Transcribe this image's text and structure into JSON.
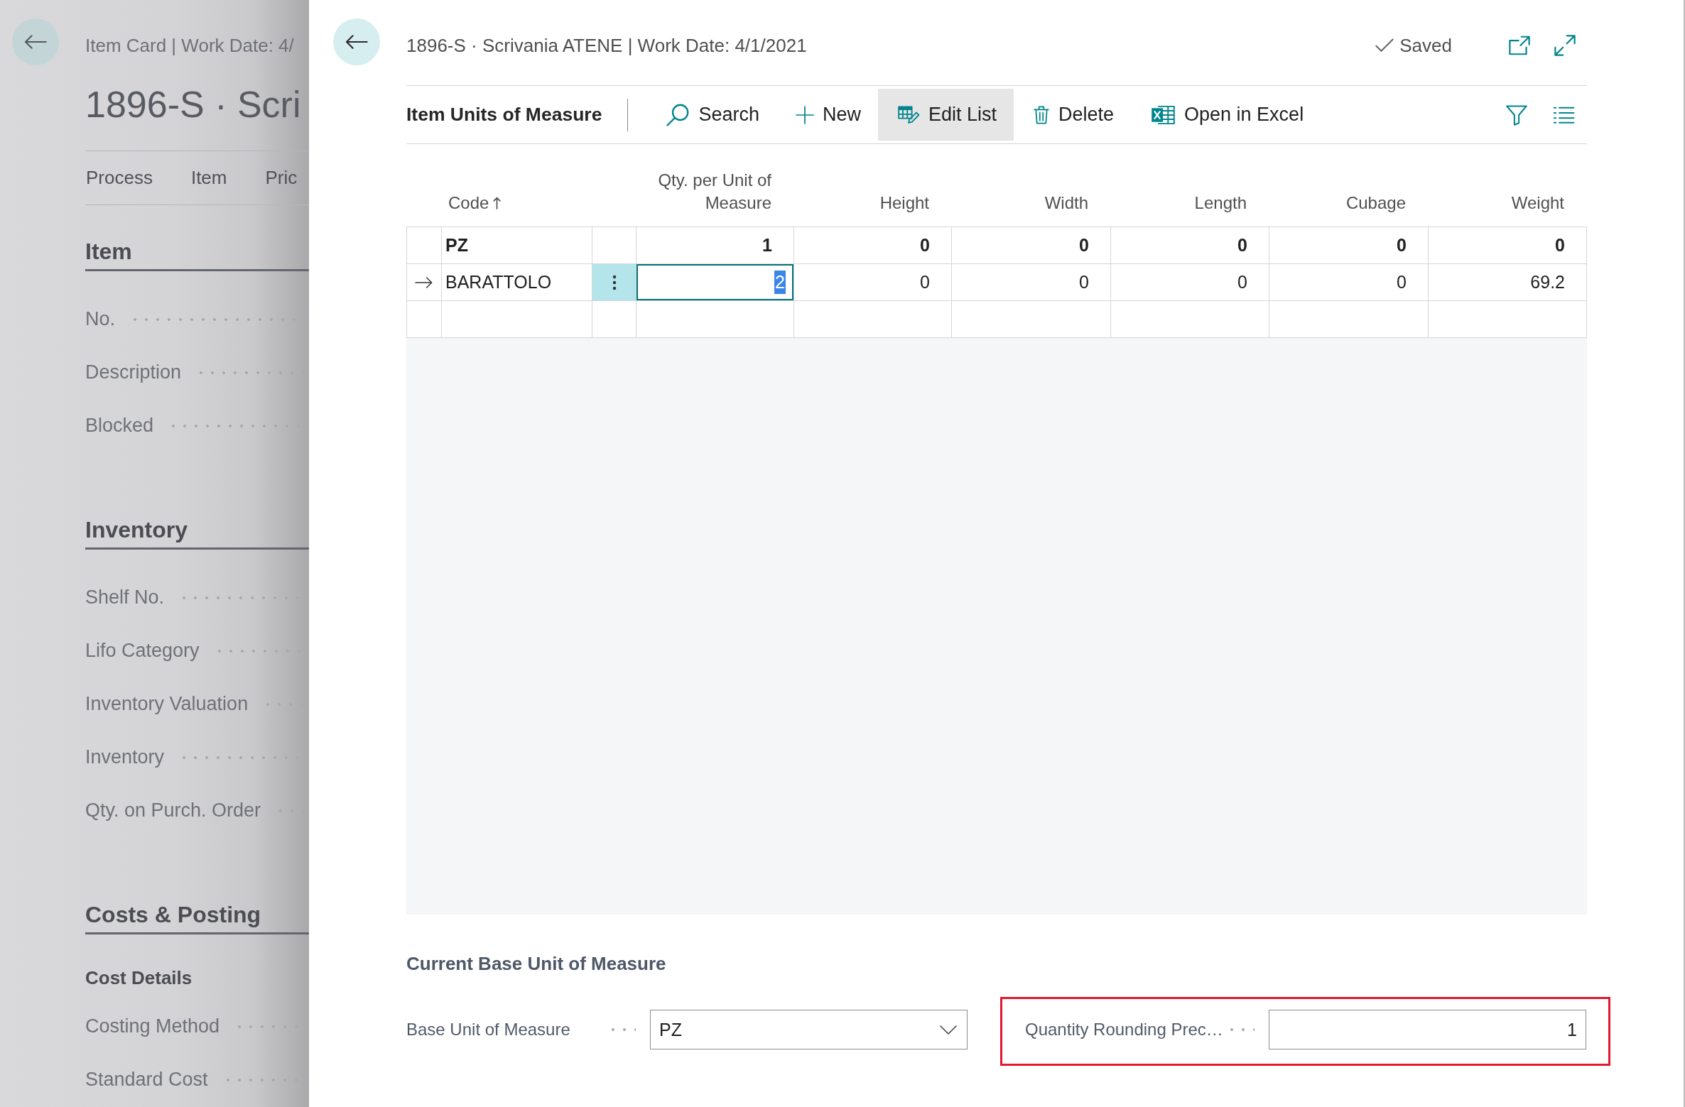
{
  "background_page": {
    "title": "Item Card | Work Date: 4/",
    "heading": "1896-S · Scri",
    "action_menus": [
      {
        "label": "Process"
      },
      {
        "label": "Item"
      },
      {
        "label": "Pric"
      }
    ],
    "sections": [
      {
        "title": "Item",
        "fields": [
          {
            "kind": "field",
            "label": "No."
          },
          {
            "kind": "field",
            "label": "Description"
          },
          {
            "kind": "field",
            "label": "Blocked"
          }
        ]
      },
      {
        "title": "Inventory",
        "fields": [
          {
            "kind": "field",
            "label": "Shelf No."
          },
          {
            "kind": "field",
            "label": "Lifo Category"
          },
          {
            "kind": "field",
            "label": "Inventory Valuation"
          },
          {
            "kind": "field",
            "label": "Inventory"
          },
          {
            "kind": "field",
            "label": "Qty. on Purch. Order"
          }
        ]
      },
      {
        "title": "Costs & Posting",
        "fields": [
          {
            "kind": "group",
            "label": "Cost Details"
          },
          {
            "kind": "field",
            "label": "Costing Method"
          },
          {
            "kind": "field",
            "label": "Standard Cost"
          }
        ]
      }
    ]
  },
  "dialog": {
    "title": "1896-S · Scrivania ATENE | Work Date: 4/1/2021",
    "save_status": "Saved",
    "toolbar": {
      "title": "Item Units of Measure",
      "actions": [
        {
          "kind": "search",
          "label": "Search",
          "pressed": false
        },
        {
          "kind": "new",
          "label": "New",
          "pressed": false
        },
        {
          "kind": "edit",
          "label": "Edit List",
          "pressed": true
        },
        {
          "kind": "delete",
          "label": "Delete",
          "pressed": false
        },
        {
          "kind": "export",
          "label": "Open in Excel",
          "pressed": false
        }
      ]
    },
    "table": {
      "columns": [
        {
          "label": "Code",
          "kind": "text",
          "sorted": true
        },
        {
          "label": "Qty. per Unit of Measure",
          "kind": "number",
          "sorted": false
        },
        {
          "label": "Height",
          "kind": "number",
          "sorted": false
        },
        {
          "label": "Width",
          "kind": "number",
          "sorted": false
        },
        {
          "label": "Length",
          "kind": "number",
          "sorted": false
        },
        {
          "label": "Cubage",
          "kind": "number",
          "sorted": false
        },
        {
          "label": "Weight",
          "kind": "number",
          "sorted": false
        }
      ],
      "rows": [
        {
          "kind": "entry",
          "current": false,
          "emphasized": true,
          "cells": [
            {
              "value": "PZ",
              "editing": false
            },
            {
              "value": "1",
              "editing": false
            },
            {
              "value": "0",
              "editing": false
            },
            {
              "value": "0",
              "editing": false
            },
            {
              "value": "0",
              "editing": false
            },
            {
              "value": "0",
              "editing": false
            },
            {
              "value": "0",
              "editing": false
            }
          ]
        },
        {
          "kind": "entry",
          "current": true,
          "emphasized": false,
          "cells": [
            {
              "value": "BARATTOLO",
              "editing": false
            },
            {
              "value": "2",
              "editing": true
            },
            {
              "value": "0",
              "editing": false
            },
            {
              "value": "0",
              "editing": false
            },
            {
              "value": "0",
              "editing": false
            },
            {
              "value": "0",
              "editing": false
            },
            {
              "value": "69.2",
              "editing": false
            }
          ]
        },
        {
          "kind": "new",
          "current": false
        }
      ]
    },
    "base_unit_section": {
      "title": "Current Base Unit of Measure",
      "fields": [
        {
          "kind": "dropdown",
          "label": "Base Unit of Measure",
          "value": "PZ",
          "highlighted": false
        },
        {
          "kind": "number",
          "label": "Quantity Rounding Prec…",
          "value": "1",
          "highlighted": true
        }
      ]
    }
  }
}
